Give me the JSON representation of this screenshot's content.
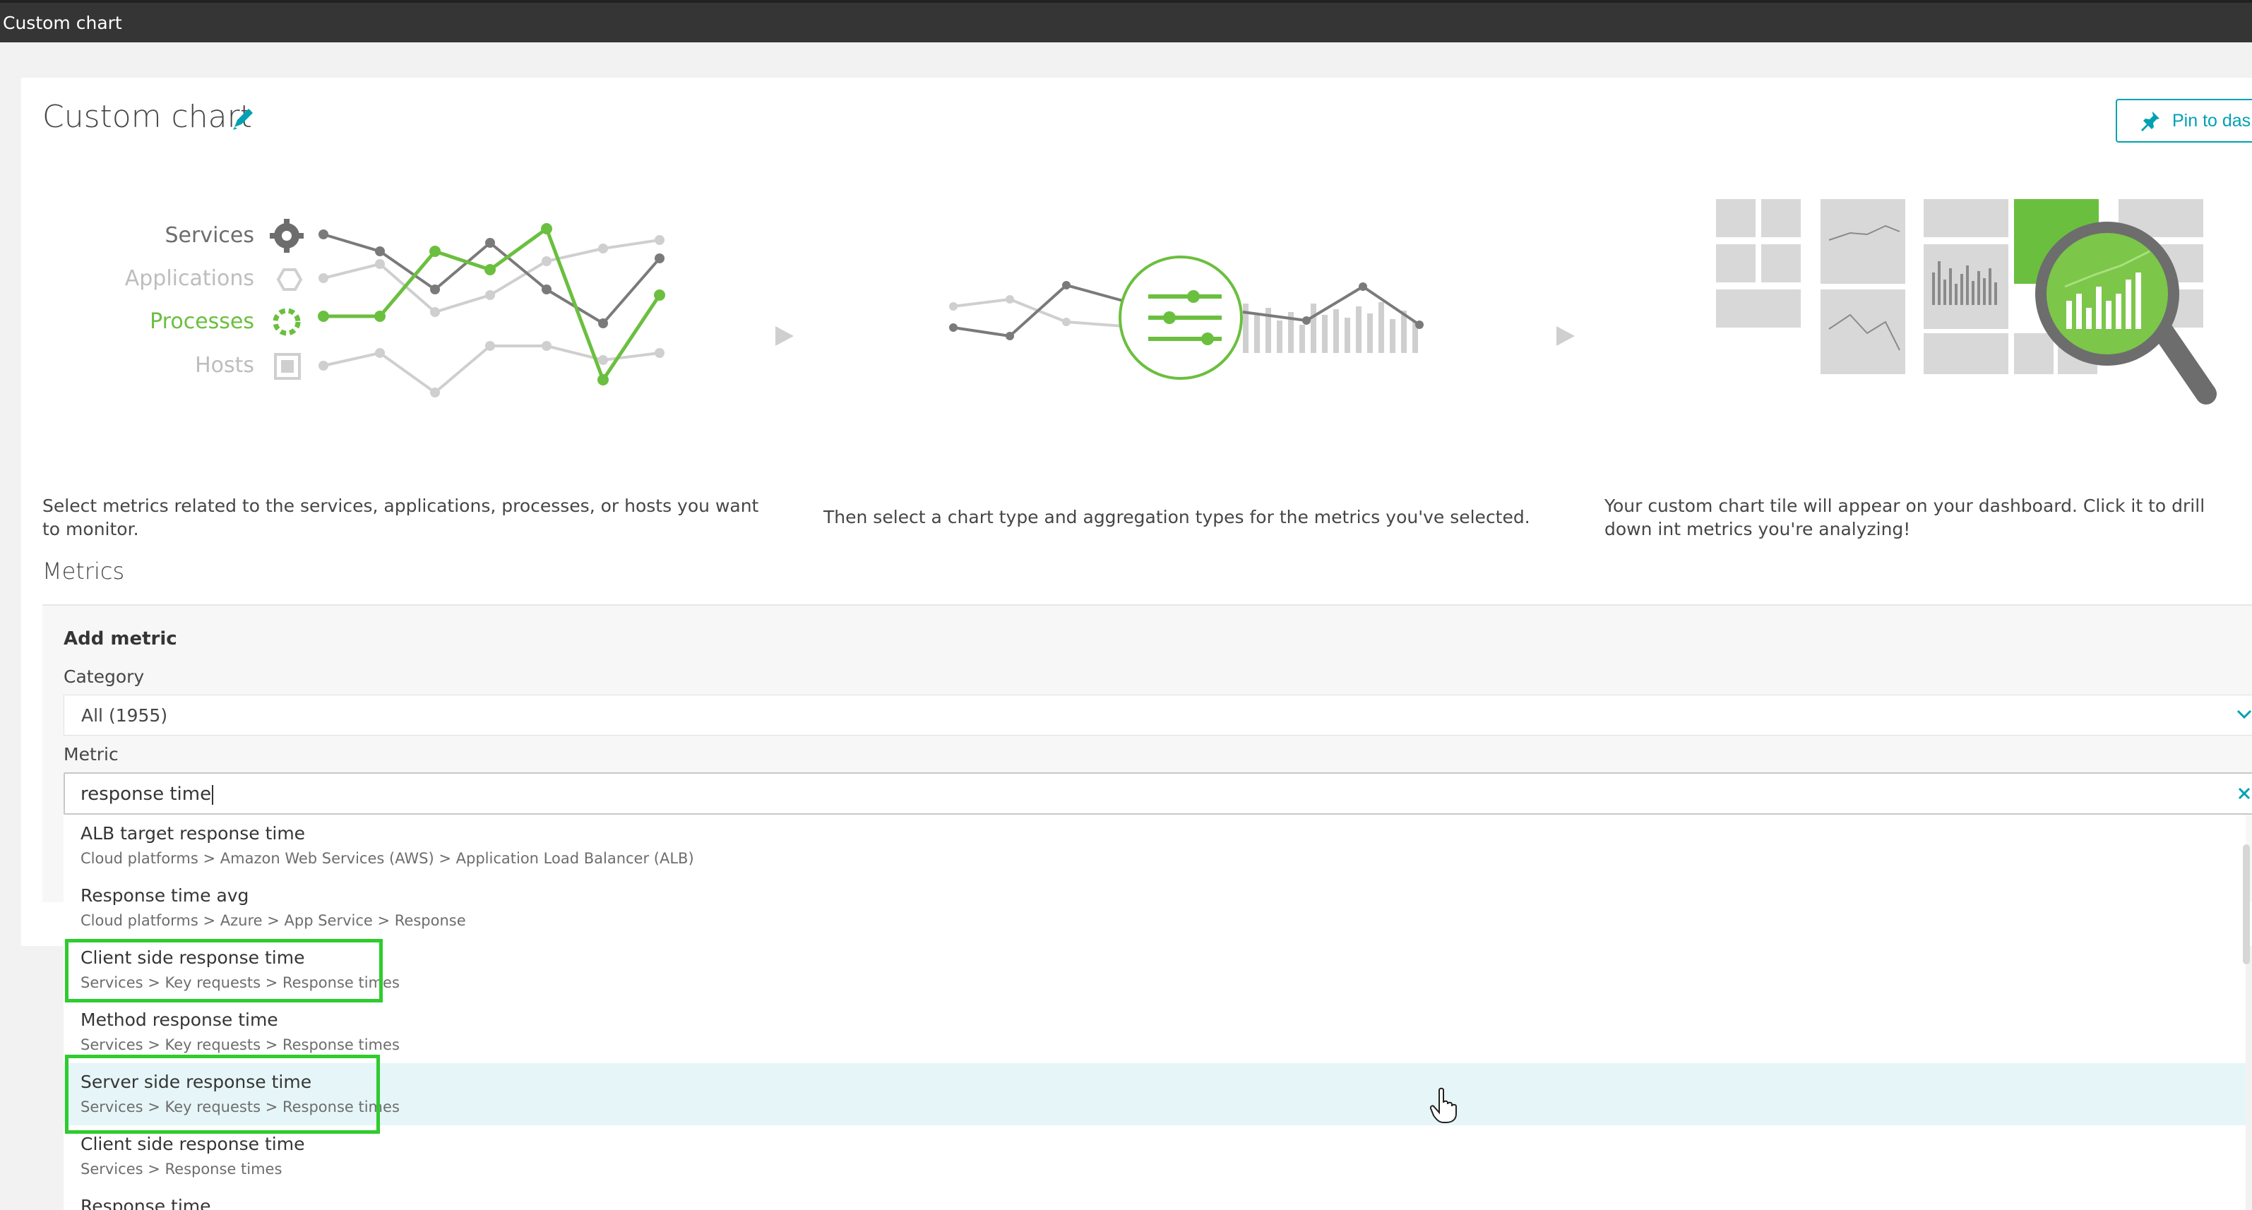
{
  "window": {
    "title": "Custom chart"
  },
  "page": {
    "title": "Custom chart",
    "pin_label": "Pin to das"
  },
  "illustration": {
    "categories": [
      "Services",
      "Applications",
      "Processes",
      "Hosts"
    ]
  },
  "steps": [
    {
      "text": "Select metrics related to the services, applications, processes, or hosts you want to monitor."
    },
    {
      "text": "Then select a chart type and aggregation types for the metrics you've selected."
    },
    {
      "text": "Your custom chart tile will appear on your dashboard. Click it to drill down int metrics you're analyzing!"
    }
  ],
  "metrics": {
    "heading": "Metrics",
    "add_metric_label": "Add metric",
    "category_label": "Category",
    "category_value": "All (1955)",
    "metric_label": "Metric",
    "metric_value": "response time"
  },
  "dropdown": {
    "items": [
      {
        "name": "ALB target response time",
        "path": "Cloud platforms > Amazon Web Services (AWS) > Application Load Balancer (ALB)"
      },
      {
        "name": "Response time avg",
        "path": "Cloud platforms > Azure > App Service > Response"
      },
      {
        "name": "Client side response time",
        "path": "Services > Key requests > Response times"
      },
      {
        "name": "Method response time",
        "path": "Services > Key requests > Response times"
      },
      {
        "name": "Server side response time",
        "path": "Services > Key requests > Response times"
      },
      {
        "name": "Client side response time",
        "path": "Services > Response times"
      },
      {
        "name": "Response time",
        "path": ""
      }
    ]
  },
  "colors": {
    "accent": "#00a1b2",
    "green": "#6bbf3f",
    "highlight_box": "#2ecc2e",
    "topbar": "#353535"
  }
}
